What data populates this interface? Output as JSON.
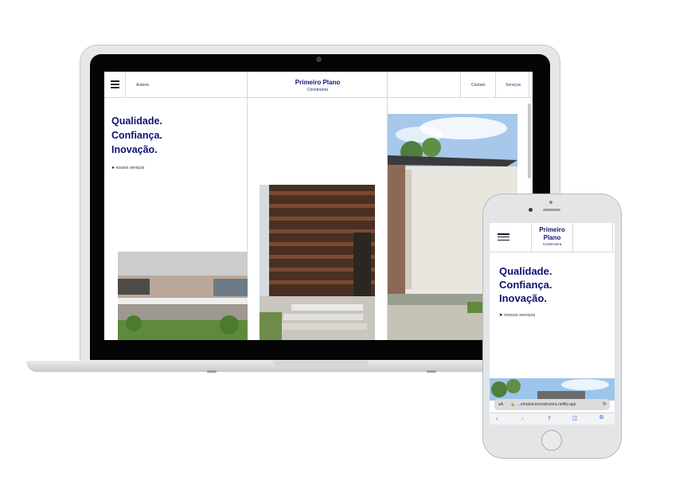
{
  "laptop_site": {
    "nav_left_link": "Autoria",
    "brand_title": "Primeiro Plano",
    "brand_subtitle": "Construtora",
    "nav_links": [
      "Contato",
      "Serviços"
    ],
    "headline": [
      "Qualidade.",
      "Confiança.",
      "Inovação."
    ],
    "cta_arrow": "➤",
    "cta_label": "nossos serviços"
  },
  "phone_site": {
    "brand_title_line1": "Primeiro",
    "brand_title_line2": "Plano",
    "brand_subtitle": "Construtora",
    "headline": [
      "Qualidade.",
      "Confiança.",
      "Inovação."
    ],
    "cta_arrow": "➤",
    "cta_label": "nossos serviços",
    "address_prefix": "aA",
    "url": "…eiroplanoconstrutora.netlify.app",
    "toolbar_icons": [
      "back-icon",
      "forward-icon",
      "share-icon",
      "bookmarks-icon",
      "tabs-icon"
    ]
  },
  "colors": {
    "brand_navy": "#0e1174",
    "nav_border": "#d8d8d8",
    "device_silver": "#e6e7e9"
  }
}
